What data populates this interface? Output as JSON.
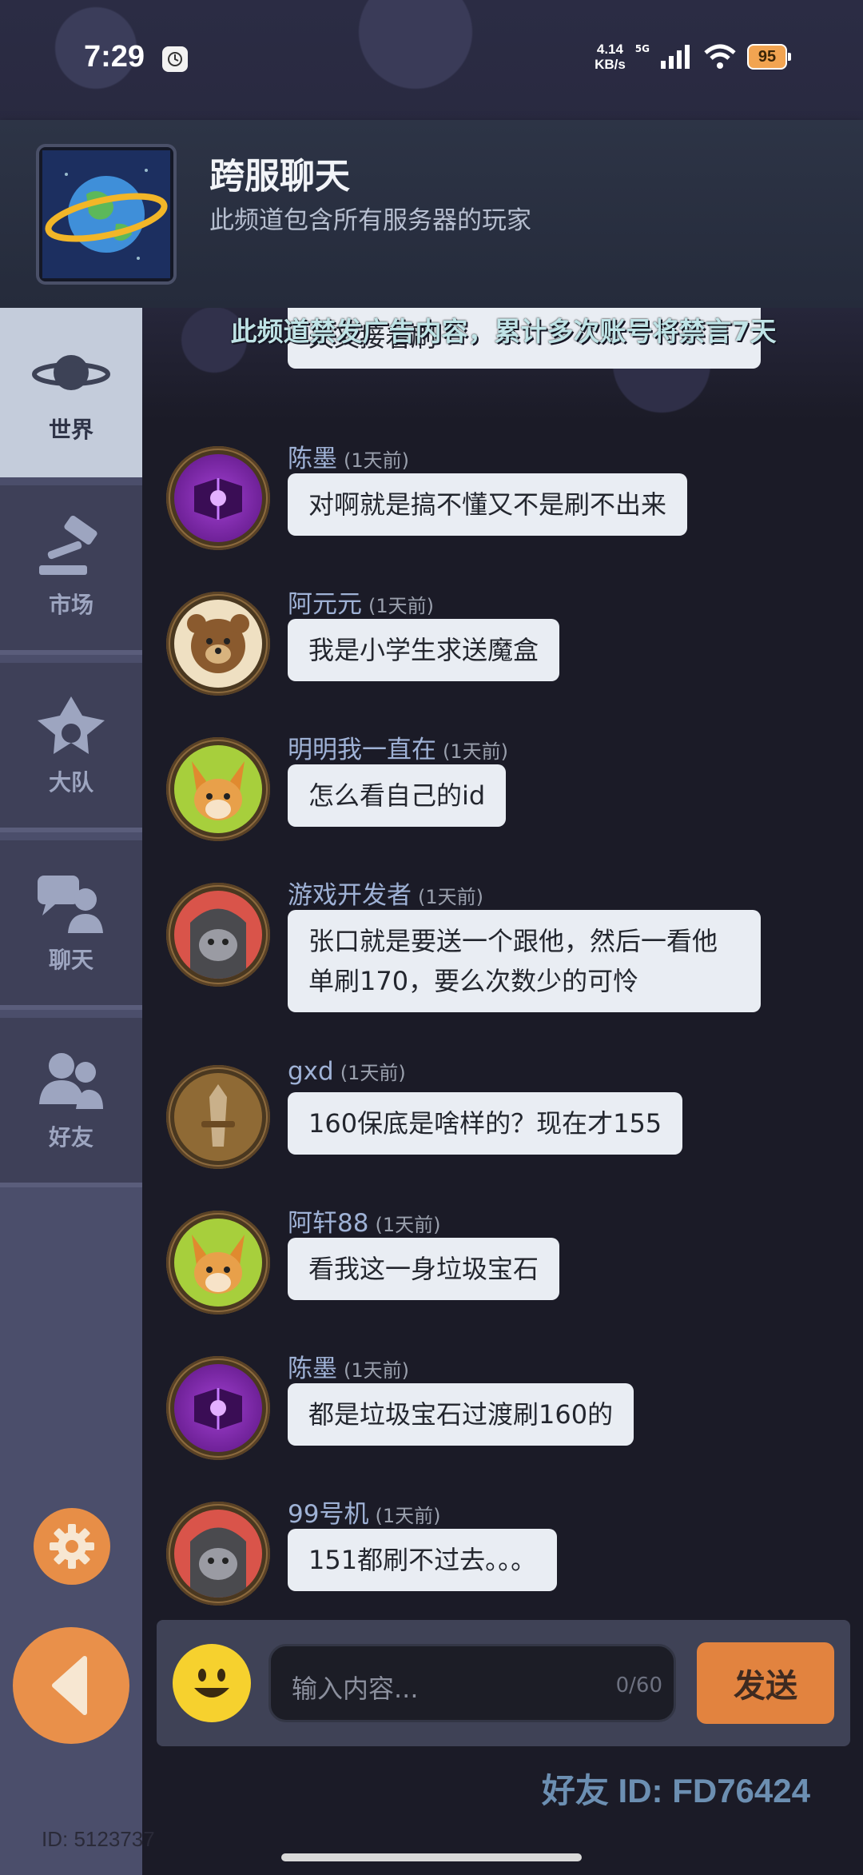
{
  "status_bar": {
    "time": "7:29",
    "net_speed_value": "4.14",
    "net_speed_unit": "KB/s",
    "network_type": "5G",
    "battery": "95"
  },
  "channel": {
    "title": "跨服聊天",
    "subtitle": "此频道包含所有服务器的玩家",
    "notice": "此频道禁发广告内容，累计多次账号将禁言7天"
  },
  "sidebar": {
    "tabs": [
      {
        "label": "世界",
        "icon": "planet-icon",
        "active": true
      },
      {
        "label": "市场",
        "icon": "gavel-icon",
        "active": false
      },
      {
        "label": "大队",
        "icon": "team-emblem-icon",
        "active": false
      },
      {
        "label": "聊天",
        "icon": "chat-icon",
        "active": false
      },
      {
        "label": "好友",
        "icon": "friends-icon",
        "active": false
      }
    ],
    "uid": "ID: 5123737"
  },
  "messages": [
    {
      "name": "",
      "time": "",
      "text": "天又接着刷",
      "avatar": "partial"
    },
    {
      "name": "陈墨",
      "time": "(1天前)",
      "text": "对啊就是搞不懂又不是刷不出来",
      "avatar": "purple-book"
    },
    {
      "name": "阿元元",
      "time": "(1天前)",
      "text": "我是小学生求送魔盒",
      "avatar": "bear"
    },
    {
      "name": "明明我一直在",
      "time": "(1天前)",
      "text": "怎么看自己的id",
      "avatar": "fox"
    },
    {
      "name": "游戏开发者",
      "time": "(1天前)",
      "text": "张口就是要送一个跟他，然后一看他单刷170，要么次数少的可怜",
      "avatar": "gray-cat"
    },
    {
      "name": "gxd",
      "time": "(1天前)",
      "text": "160保底是啥样的？现在才155",
      "avatar": "sword"
    },
    {
      "name": "阿轩88",
      "time": "(1天前)",
      "text": "看我这一身垃圾宝石",
      "avatar": "fox"
    },
    {
      "name": "陈墨",
      "time": "(1天前)",
      "text": "都是垃圾宝石过渡刷160的",
      "avatar": "purple-book"
    },
    {
      "name": "99号机",
      "time": "(1天前)",
      "text": "151都刷不过去。。。",
      "avatar": "gray-cat"
    }
  ],
  "input": {
    "placeholder": "输入内容...",
    "counter": "0/60",
    "send_label": "发送"
  },
  "friend_id": "好友 ID: FD76424",
  "colors": {
    "accent_orange": "#e2833f",
    "bubble": "#e9edf3",
    "name_blue": "#9fb2d6"
  }
}
